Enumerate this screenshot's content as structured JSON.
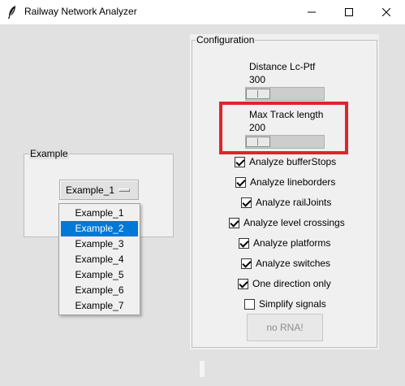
{
  "window": {
    "title": "Railway Network Analyzer",
    "controls": {
      "minimize": "—",
      "maximize": "☐",
      "close": "✕"
    }
  },
  "example": {
    "group_label": "Example",
    "selected": "Example_1",
    "options": [
      "Example_1",
      "Example_2",
      "Example_3",
      "Example_4",
      "Example_5",
      "Example_6",
      "Example_7"
    ],
    "highlighted_option": "Example_2"
  },
  "configuration": {
    "group_label": "Configuration",
    "distance_slider": {
      "label": "Distance Lc-Ptf",
      "value": "300"
    },
    "track_slider": {
      "label": "Max Track length",
      "value": "200"
    },
    "checkboxes": [
      {
        "label": "Analyze bufferStops",
        "checked": true
      },
      {
        "label": "Analyze lineborders",
        "checked": true
      },
      {
        "label": "Analyze railJoints",
        "checked": true
      },
      {
        "label": "Analyze level crossings",
        "checked": true
      },
      {
        "label": "Analyze platforms",
        "checked": true
      },
      {
        "label": "Analyze switches",
        "checked": true
      },
      {
        "label": "One direction only",
        "checked": true
      },
      {
        "label": "Simplify signals",
        "checked": false
      }
    ],
    "rna_button": "no RNA!"
  },
  "colors": {
    "highlight": "#e0242b",
    "selection": "#0078d7"
  }
}
